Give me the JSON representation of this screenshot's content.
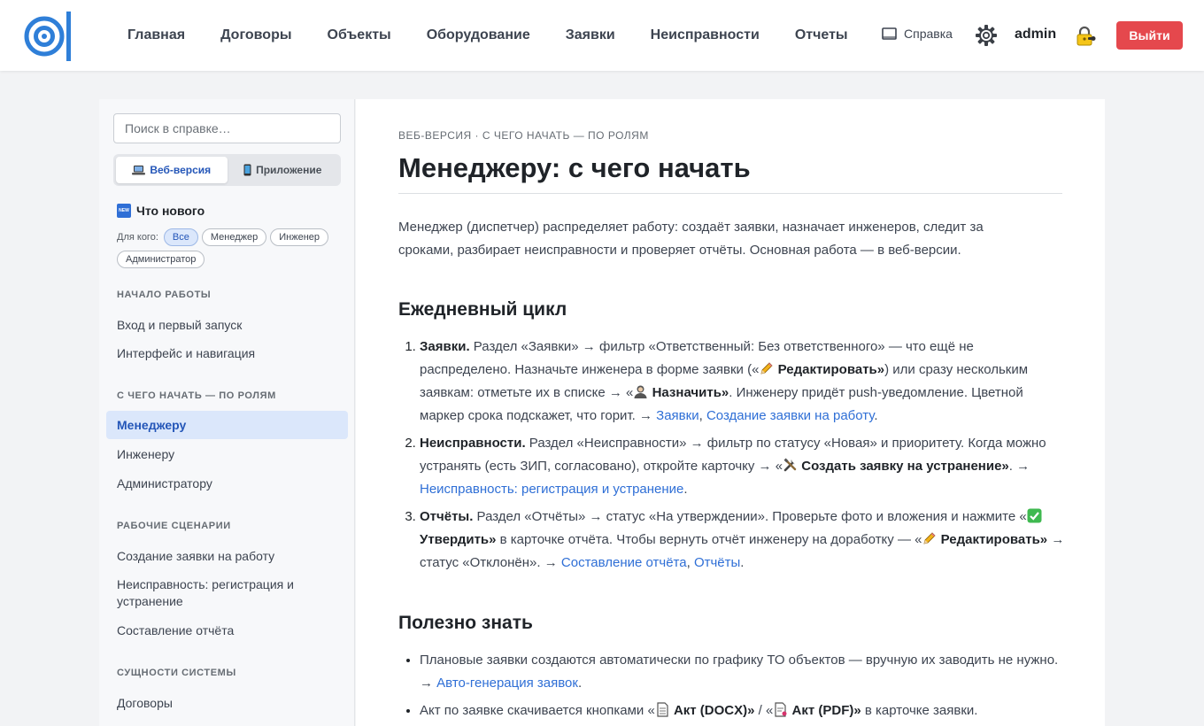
{
  "header": {
    "nav": [
      "Главная",
      "Договоры",
      "Объекты",
      "Оборудование",
      "Заявки",
      "Неисправности",
      "Отчеты"
    ],
    "help": "Справка",
    "user": "admin",
    "logout": "Выйти",
    "accent": "#2f7fd8",
    "logout_color": "#e5484d"
  },
  "sidebar": {
    "search_placeholder": "Поиск в справке…",
    "seg_web": "Веб-версия",
    "seg_app": "Приложение",
    "whats_new": "Что нового",
    "new_badge": "NEW",
    "audience_label": "Для кого:",
    "audience": [
      "Все",
      "Менеджер",
      "Инженер",
      "Администратор"
    ],
    "sections": [
      {
        "title": "НАЧАЛО РАБОТЫ",
        "items": [
          "Вход и первый запуск",
          "Интерфейс и навигация"
        ]
      },
      {
        "title": "С ЧЕГО НАЧАТЬ — ПО РОЛЯМ",
        "items": [
          "Менеджеру",
          "Инженеру",
          "Администратору"
        ]
      },
      {
        "title": "РАБОЧИЕ СЦЕНАРИИ",
        "items": [
          "Создание заявки на работу",
          "Неисправность: регистрация и устранение",
          "Составление отчёта"
        ]
      },
      {
        "title": "СУЩНОСТИ СИСТЕМЫ",
        "items": [
          "Договоры"
        ]
      }
    ]
  },
  "article": {
    "breadcrumb": "ВЕБ-ВЕРСИЯ · С ЧЕГО НАЧАТЬ — ПО РОЛЯМ",
    "title": "Менеджеру: с чего начать",
    "intro": "Менеджер (диспетчер) распределяет работу: создаёт заявки, назначает инженеров, следит за сроками, разбирает неисправности и проверяет отчёты. Основная работа — в веб-версии.",
    "h_daily": "Ежедневный цикл",
    "step1": {
      "title": "Заявки.",
      "t1": " Раздел «Заявки» → фильтр «Ответственный: Без ответственного» — что ещё не распределено. Назначьте инженера в форме заявки («",
      "b1": " Редактировать»",
      "t2": ") или сразу нескольким заявкам: отметьте их в списке → «",
      "b2": " Назначить»",
      "t3": ". Инженеру придёт push-уведомление. Цветной маркер срока подскажет, что горит. → ",
      "l1": "Заявки",
      "sep": ", ",
      "l2": "Создание заявки на работу",
      "end": "."
    },
    "step2": {
      "title": "Неисправности.",
      "t1": " Раздел «Неисправности» → фильтр по статусу «Новая» и приоритету. Когда можно устранять (есть ЗИП, согласовано), откройте карточку → «",
      "b1": " Создать заявку на устранение»",
      "t2": ". → ",
      "l1": "Неисправность: регистрация и устранение",
      "end": "."
    },
    "step3": {
      "title": "Отчёты.",
      "t1": " Раздел «Отчёты» → статус «На утверждении». Проверьте фото и вложения и нажмите «",
      "b1": " Утвердить»",
      "t2": " в карточке отчёта. Чтобы вернуть отчёт инженеру на доработку — «",
      "b2": " Редактировать»",
      "t3": " → статус «Отклонён». → ",
      "l1": "Составление отчёта",
      "sep": ", ",
      "l2": "Отчёты",
      "end": "."
    },
    "h_useful": "Полезно знать",
    "tip1": {
      "t1": "Плановые заявки создаются автоматически по графику ТО объектов — вручную их заводить не нужно. → ",
      "l1": "Авто-генерация заявок",
      "end": "."
    },
    "tip2": {
      "t1": "Акт по заявке скачивается кнопками «",
      "b1": " Акт (DOCX)»",
      "t2": " / «",
      "b2": " Акт (PDF)»",
      "t3": " в карточке заявки."
    }
  }
}
